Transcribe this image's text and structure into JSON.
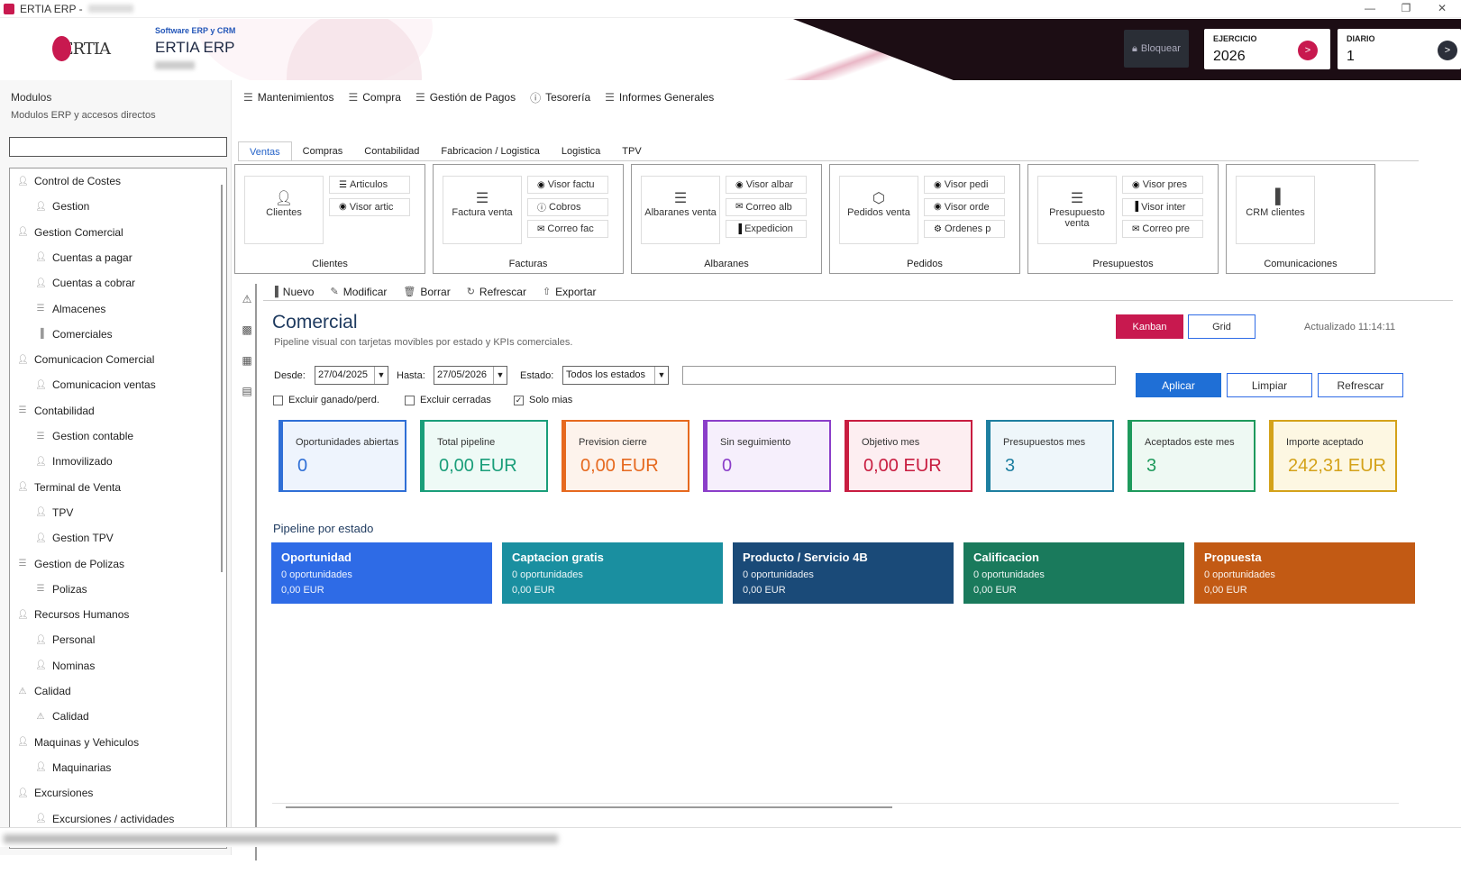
{
  "window": {
    "title": "ERTIA ERP -",
    "controls": [
      "—",
      "❐",
      "✕"
    ]
  },
  "header": {
    "logo_text": "ERTIA",
    "subtitle": "Software ERP y CRM",
    "title": "ERTIA ERP",
    "lock_label": "Bloquear",
    "ejercicio": {
      "label": "EJERCICIO",
      "value": "2026",
      "button": ">",
      "color": "#c8194f"
    },
    "diario": {
      "label": "DIARIO",
      "value": "1",
      "button": ">",
      "color": "#2b2f3a"
    }
  },
  "sidebar": {
    "title": "Modulos",
    "subtitle": "Modulos ERP y accesos directos",
    "search_value": "",
    "items": [
      {
        "label": "Control de Costes",
        "level": 0,
        "icon": "person-icon"
      },
      {
        "label": "Gestion",
        "level": 1,
        "icon": "person-icon"
      },
      {
        "label": "Gestion Comercial",
        "level": 0,
        "icon": "person-icon"
      },
      {
        "label": "Cuentas a pagar",
        "level": 1,
        "icon": "person-icon"
      },
      {
        "label": "Cuentas a cobrar",
        "level": 1,
        "icon": "person-icon"
      },
      {
        "label": "Almacenes",
        "level": 1,
        "icon": "document-icon"
      },
      {
        "label": "Comerciales",
        "level": 1,
        "icon": "chart-icon"
      },
      {
        "label": "Comunicacion Comercial",
        "level": 0,
        "icon": "person-icon"
      },
      {
        "label": "Comunicacion ventas",
        "level": 1,
        "icon": "person-icon"
      },
      {
        "label": "Contabilidad",
        "level": 0,
        "icon": "document-icon"
      },
      {
        "label": "Gestion contable",
        "level": 1,
        "icon": "document-icon"
      },
      {
        "label": "Inmovilizado",
        "level": 1,
        "icon": "person-icon"
      },
      {
        "label": "Terminal de Venta",
        "level": 0,
        "icon": "person-icon"
      },
      {
        "label": "TPV",
        "level": 1,
        "icon": "person-icon"
      },
      {
        "label": "Gestion TPV",
        "level": 1,
        "icon": "person-icon"
      },
      {
        "label": "Gestion de Polizas",
        "level": 0,
        "icon": "document-icon"
      },
      {
        "label": "Polizas",
        "level": 1,
        "icon": "document-icon"
      },
      {
        "label": "Recursos Humanos",
        "level": 0,
        "icon": "person-icon"
      },
      {
        "label": "Personal",
        "level": 1,
        "icon": "person-icon"
      },
      {
        "label": "Nominas",
        "level": 1,
        "icon": "person-icon"
      },
      {
        "label": "Calidad",
        "level": 0,
        "icon": "warning-icon"
      },
      {
        "label": "Calidad",
        "level": 1,
        "icon": "warning-icon"
      },
      {
        "label": "Maquinas y Vehiculos",
        "level": 0,
        "icon": "person-icon"
      },
      {
        "label": "Maquinarias",
        "level": 1,
        "icon": "person-icon"
      },
      {
        "label": "Excursiones",
        "level": 0,
        "icon": "person-icon"
      },
      {
        "label": "Excursiones / actividades",
        "level": 1,
        "icon": "person-icon"
      }
    ]
  },
  "menu": [
    "Mantenimientos",
    "Compra",
    "Gestión de Pagos",
    "Tesorería",
    "Informes Generales"
  ],
  "tabs": [
    "Ventas",
    "Compras",
    "Contabilidad",
    "Fabricacion / Logistica",
    "Logistica",
    "TPV"
  ],
  "ribbon": {
    "groups": [
      {
        "label": "Clientes",
        "big": {
          "label": "Clientes",
          "icon": "person-icon"
        },
        "small": [
          {
            "label": "Articulos",
            "icon": "document-icon"
          },
          {
            "label": "Visor artic",
            "icon": "eye-icon"
          }
        ]
      },
      {
        "label": "Facturas",
        "big": {
          "label": "Factura venta",
          "icon": "document-icon"
        },
        "small": [
          {
            "label": "Visor factu",
            "icon": "eye-icon"
          },
          {
            "label": "Cobros",
            "icon": "info-icon"
          },
          {
            "label": "Correo fac",
            "icon": "mail-icon"
          }
        ]
      },
      {
        "label": "Albaranes",
        "big": {
          "label": "Albaranes venta",
          "icon": "document-icon"
        },
        "small": [
          {
            "label": "Visor albar",
            "icon": "eye-icon"
          },
          {
            "label": "Correo alb",
            "icon": "mail-icon"
          },
          {
            "label": "Expedicion",
            "icon": "chart-icon"
          }
        ]
      },
      {
        "label": "Pedidos",
        "big": {
          "label": "Pedidos venta",
          "icon": "box-icon"
        },
        "small": [
          {
            "label": "Visor pedi",
            "icon": "eye-icon"
          },
          {
            "label": "Visor orde",
            "icon": "eye-icon"
          },
          {
            "label": "Ordenes p",
            "icon": "gear-icon"
          }
        ]
      },
      {
        "label": "Presupuestos",
        "big": {
          "label": "Presupuesto venta",
          "icon": "document-icon"
        },
        "small": [
          {
            "label": "Visor pres",
            "icon": "eye-icon"
          },
          {
            "label": "Visor inter",
            "icon": "chart-icon"
          },
          {
            "label": "Correo pre",
            "icon": "mail-icon"
          }
        ]
      },
      {
        "label": "Comunicaciones",
        "big": {
          "label": "CRM clientes",
          "icon": "chart-icon"
        },
        "small": []
      }
    ]
  },
  "actions": [
    {
      "label": "Nuevo",
      "icon": "chart-icon"
    },
    {
      "label": "Modificar",
      "icon": "pencil-icon"
    },
    {
      "label": "Borrar",
      "icon": "trash-icon"
    },
    {
      "label": "Refrescar",
      "icon": "refresh-icon"
    },
    {
      "label": "Exportar",
      "icon": "export-icon"
    }
  ],
  "content": {
    "title": "Comercial",
    "subtitle": "Pipeline visual con tarjetas movibles por estado y KPIs comerciales.",
    "view_kanban": "Kanban",
    "view_grid": "Grid",
    "updated": "Actualizado 11:14:11",
    "filters": {
      "desde_label": "Desde:",
      "desde_value": "27/04/2025",
      "hasta_label": "Hasta:",
      "hasta_value": "27/05/2026",
      "estado_label": "Estado:",
      "estado_value": "Todos los estados",
      "search_value": "",
      "apply": "Aplicar",
      "clear": "Limpiar",
      "refresh": "Refrescar",
      "excluir_ganado": {
        "label": "Excluir ganado/perd.",
        "checked": false
      },
      "excluir_cerradas": {
        "label": "Excluir cerradas",
        "checked": false
      },
      "solo_mias": {
        "label": "Solo mias",
        "checked": true
      }
    },
    "kpis": [
      {
        "label": "Oportunidades abiertas",
        "value": "0",
        "color": "#2f6fd6",
        "bg": "#eef4fd"
      },
      {
        "label": "Total pipeline",
        "value": "0,00 EUR",
        "color": "#1a9e7a",
        "bg": "#eefaf6"
      },
      {
        "label": "Prevision cierre",
        "value": "0,00 EUR",
        "color": "#e6691f",
        "bg": "#fdf3ec"
      },
      {
        "label": "Sin seguimiento",
        "value": "0",
        "color": "#8b3ec9",
        "bg": "#f6effc"
      },
      {
        "label": "Objetivo mes",
        "value": "0,00 EUR",
        "color": "#c81d40",
        "bg": "#fdeef1"
      },
      {
        "label": "Presupuestos mes",
        "value": "3",
        "color": "#1e7fa0",
        "bg": "#eef6fa"
      },
      {
        "label": "Aceptados este mes",
        "value": "3",
        "color": "#1e9a5c",
        "bg": "#eef9f3"
      },
      {
        "label": "Importe aceptado",
        "value": "242,31 EUR",
        "color": "#d4a21a",
        "bg": "#fdf7e2"
      }
    ],
    "pipeline_title": "Pipeline por estado",
    "stages": [
      {
        "name": "Oportunidad",
        "count": "0 oportunidades",
        "amount": "0,00 EUR",
        "color": "#2e6be6"
      },
      {
        "name": "Captacion gratis",
        "count": "0 oportunidades",
        "amount": "0,00 EUR",
        "color": "#1a8fa0"
      },
      {
        "name": "Producto / Servicio 4B",
        "count": "0 oportunidades",
        "amount": "0,00 EUR",
        "color": "#1a4a78"
      },
      {
        "name": "Calificacion",
        "count": "0 oportunidades",
        "amount": "0,00 EUR",
        "color": "#1a7a5c"
      },
      {
        "name": "Propuesta",
        "count": "0 oportunidades",
        "amount": "0,00 EUR",
        "color": "#c25a14"
      }
    ]
  },
  "status": {
    "text": ""
  }
}
